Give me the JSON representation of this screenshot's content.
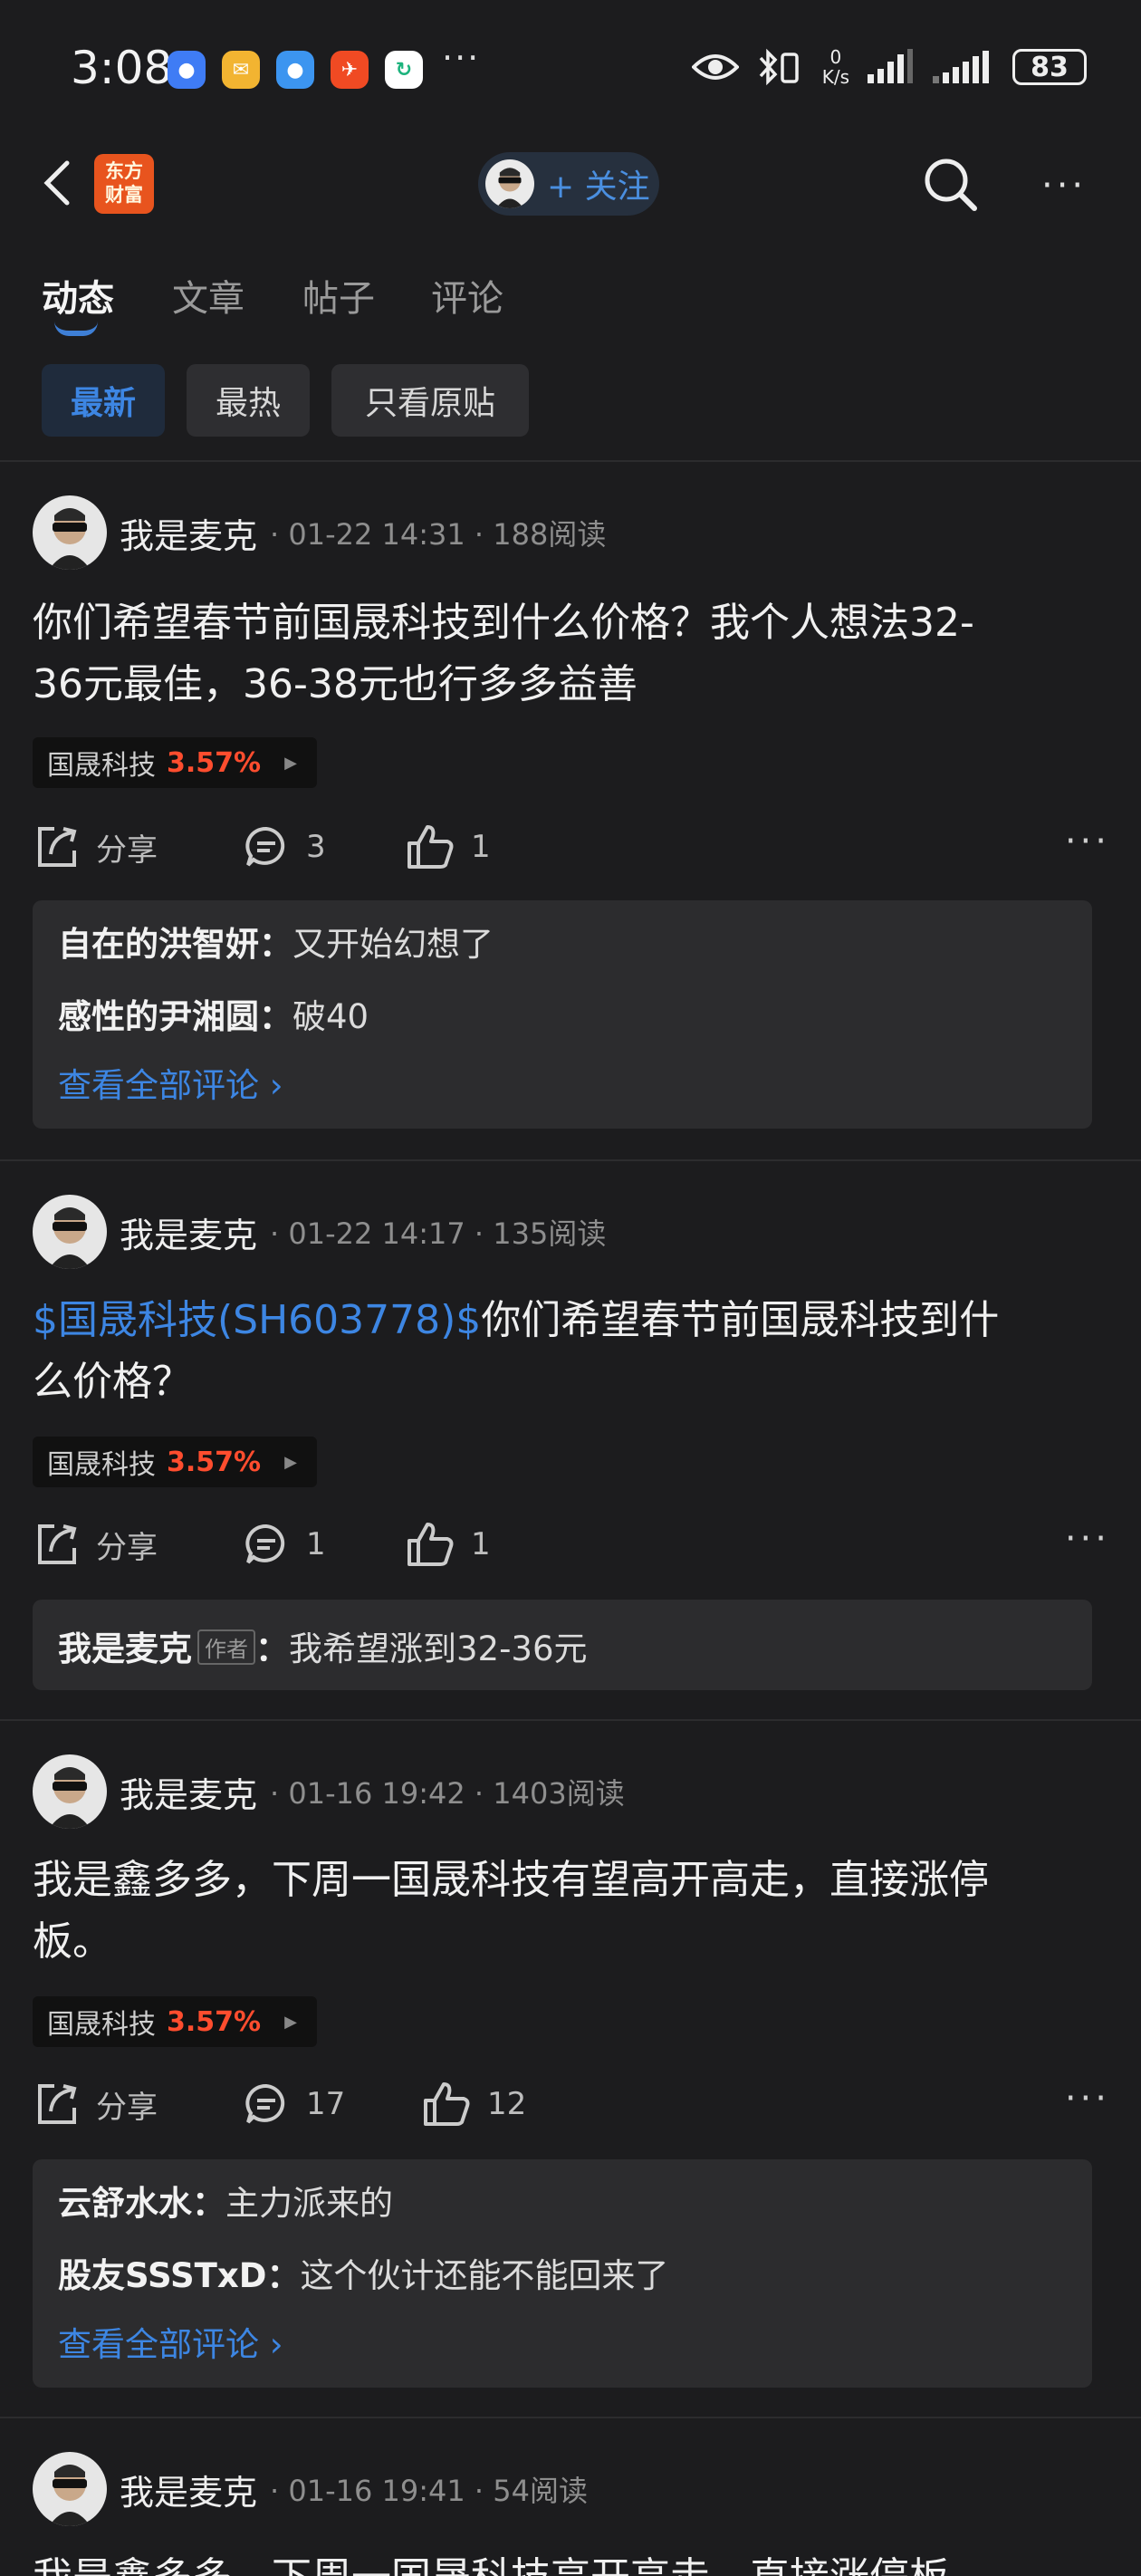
{
  "status_bar": {
    "time": "3:08",
    "more": "···",
    "net_speed_value": "0",
    "net_speed_unit": "K/s",
    "battery": "83"
  },
  "nav": {
    "brand_logo_line1": "东方",
    "brand_logo_line2": "财富",
    "follow_label": "+ 关注"
  },
  "tabs": [
    {
      "label": "动态",
      "active": true
    },
    {
      "label": "文章",
      "active": false
    },
    {
      "label": "帖子",
      "active": false
    },
    {
      "label": "评论",
      "active": false
    }
  ],
  "filters": [
    {
      "label": "最新",
      "active": true
    },
    {
      "label": "最热",
      "active": false
    },
    {
      "label": "只看原贴",
      "active": false
    }
  ],
  "posts": [
    {
      "author": "我是麦克",
      "meta": "· 01-22 14:31 · 188阅读",
      "text_line1": "你们希望春节前国晟科技到什么价格？我个人想法32-",
      "text_line2": "36元最佳，36-38元也行多多益善",
      "stock_name": "国晟科技",
      "stock_change": "3.57%",
      "share_label": "分享",
      "comment_count": "3",
      "like_count": "1",
      "comments": [
        {
          "user": "自在的洪智妍",
          "sep": "：",
          "text": "又开始幻想了"
        },
        {
          "user": "感性的尹湘圆",
          "sep": "：",
          "text": "破40"
        }
      ],
      "view_all": "查看全部评论 ›"
    },
    {
      "author": "我是麦克",
      "meta": "· 01-22 14:17 · 135阅读",
      "cashtag": "$国晟科技(SH603778)$",
      "text_line1": "你们希望春节前国晟科技到什",
      "text_line2": "么价格？",
      "stock_name": "国晟科技",
      "stock_change": "3.57%",
      "share_label": "分享",
      "comment_count": "1",
      "like_count": "1",
      "comments": [
        {
          "user": "我是麦克",
          "badge": "作者",
          "sep": "：",
          "text": "我希望涨到32-36元"
        }
      ]
    },
    {
      "author": "我是麦克",
      "meta": "· 01-16 19:42 · 1403阅读",
      "text_line1": "我是鑫多多，下周一国晟科技有望高开高走，直接涨停",
      "text_line2": "板。",
      "stock_name": "国晟科技",
      "stock_change": "3.57%",
      "share_label": "分享",
      "comment_count": "17",
      "like_count": "12",
      "comments": [
        {
          "user": "云舒水水",
          "sep": "：",
          "text": "主力派来的"
        },
        {
          "user": "股友SSSTxD",
          "sep": "：",
          "text": "这个伙计还能不能回来了"
        }
      ],
      "view_all": "查看全部评论 ›"
    },
    {
      "author": "我是麦克",
      "meta": "· 01-16 19:41 · 54阅读",
      "text_line1": "我是鑫多多，下周一国晟科技高开高走，直接涨停板"
    }
  ]
}
